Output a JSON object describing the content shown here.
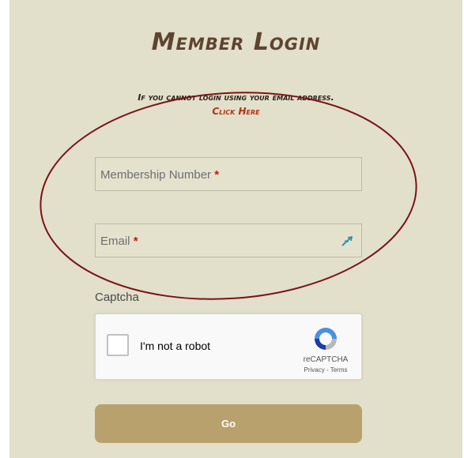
{
  "login": {
    "title": "Member Login",
    "notice": "If you cannot login using your email address.",
    "click_here": "Click Here"
  },
  "fields": {
    "membership": {
      "label": "Membership Number",
      "required_mark": "*"
    },
    "email": {
      "label": "Email",
      "required_mark": "*",
      "icon": "autofill-arrow-icon"
    }
  },
  "captcha": {
    "label": "Captcha",
    "checkbox_text": "I'm not a robot",
    "brand": "reCAPTCHA",
    "links": "Privacy - Terms",
    "logo": "recaptcha-logo-icon"
  },
  "submit": {
    "label": "Go"
  },
  "colors": {
    "background": "#e2dfca",
    "title": "#5e4430",
    "link": "#b0331a",
    "button": "#b8a16d",
    "annotation_oval": "#7a1416"
  }
}
